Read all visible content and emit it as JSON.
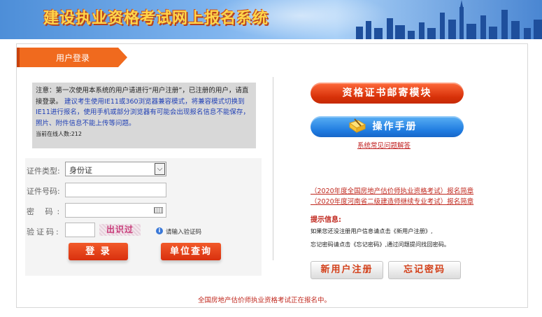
{
  "banner": {
    "title": "建设执业资格考试网上报名系统"
  },
  "tab": {
    "label": "用户登录"
  },
  "notice": {
    "text1": "注意：第一次使用本系统的用户请进行“用户注册”，已注册的用户，请直接登录。",
    "text2": "建议考生使用IE11或360浏览器兼容模式，将兼容模式切换到IE11进行报名，使用手机或部分浏览器有可能会出现报名信息不能保存，照片、附件信息不能上传等问题。",
    "online": "当前在线人数:212"
  },
  "form": {
    "cert_type_label": "证件类型:",
    "cert_type_value": "身份证",
    "cert_no_label": "证件号码:",
    "password_label": "密 码:",
    "verify_label": "验证码:",
    "captcha_text": "出识过",
    "verify_hint": "请输入验证码",
    "login_button": "登 录",
    "org_query_button": "单位查询"
  },
  "right": {
    "mail_button": "资格证书邮寄模块",
    "manual_button": "操作手册",
    "faq_link": "系统常见问题解答",
    "news": [
      "（2020年度全国房地产估价师执业资格考试）报名简章",
      "（2020年度河南省二级建造师继续专业考试）报名简章"
    ],
    "tips_title": "提示信息:",
    "tip1": "如果您还没注册用户信息请点击《新用户注册》,",
    "tip2": "忘记密码请点击《忘记密码》,通过问题提问找回密码。",
    "register_button": "新用户注册",
    "forgot_button": "忘记密码"
  },
  "footer": {
    "text": "全国房地产估价师执业资格考试正在报名中。"
  },
  "colors": {
    "accent": "#d9300e",
    "link": "#c0281e",
    "notice_blue": "#1f3fb5"
  }
}
